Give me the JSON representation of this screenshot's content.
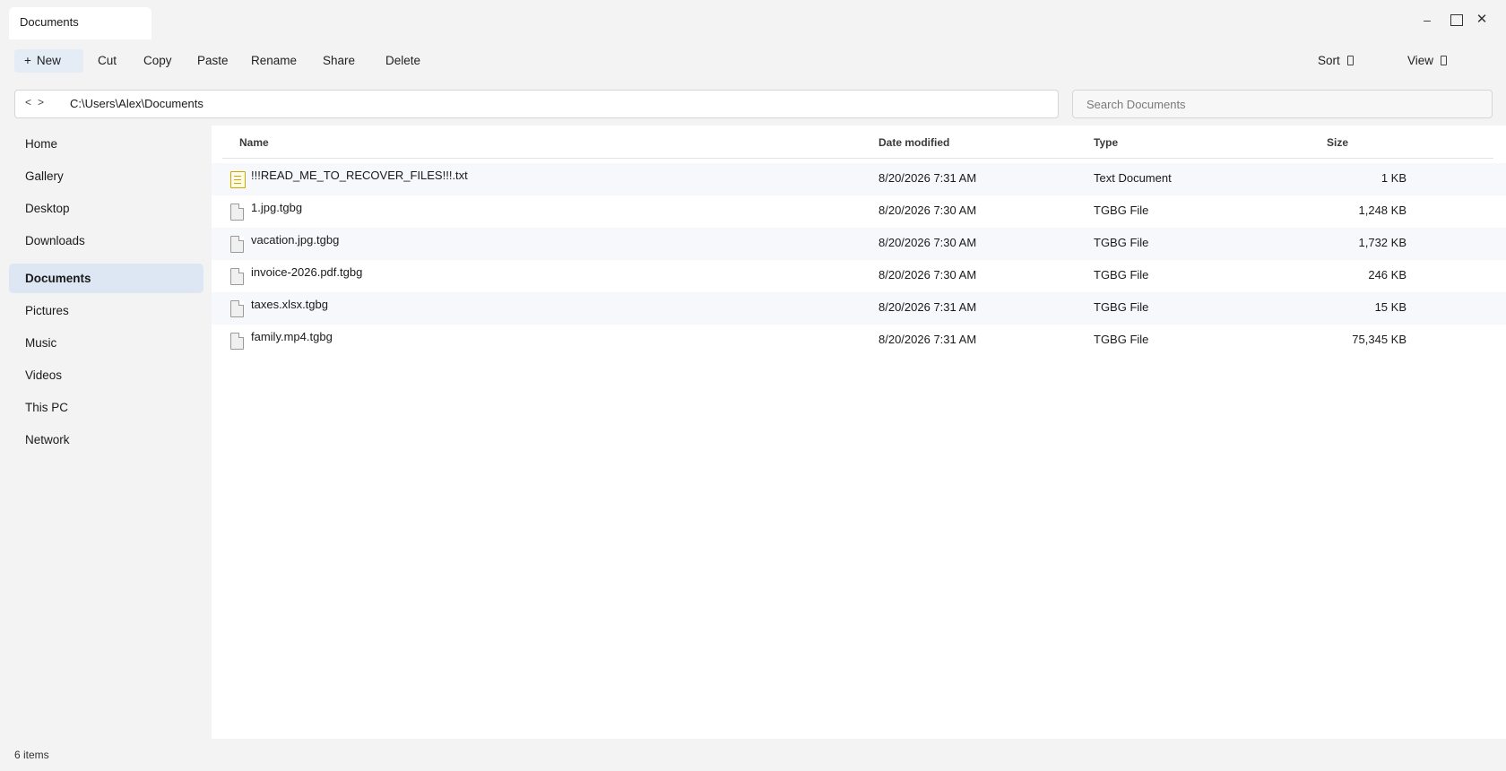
{
  "window": {
    "tab_title": "Documents",
    "controls": {
      "minimize": "–",
      "close": "✕"
    }
  },
  "toolbar": {
    "new_label": "New",
    "new_plus": "+",
    "cut_label": "Cut",
    "copy_label": "Copy",
    "paste_label": "Paste",
    "rename_label": "Rename",
    "share_label": "Share",
    "delete_label": "Delete",
    "sort_label": "Sort",
    "view_label": "View"
  },
  "address": {
    "back": "<",
    "forward": ">",
    "path": "C:\\Users\\Alex\\Documents"
  },
  "search": {
    "placeholder": "Search Documents"
  },
  "sidebar": {
    "items": [
      {
        "label": "Home"
      },
      {
        "label": "Gallery"
      },
      {
        "label": "Desktop"
      },
      {
        "label": "Downloads"
      },
      {
        "label": "Documents",
        "active": true
      },
      {
        "label": "Pictures"
      },
      {
        "label": "Music"
      },
      {
        "label": "Videos"
      },
      {
        "label": "This PC"
      },
      {
        "label": "Network"
      }
    ]
  },
  "table": {
    "headers": {
      "name": "Name",
      "date": "Date modified",
      "type": "Type",
      "size": "Size"
    },
    "rows": [
      {
        "name": "!!!READ_ME_TO_RECOVER_FILES!!!.txt",
        "date": "8/20/2026 7:31 AM",
        "type": "Text Document",
        "size": "1 KB",
        "icon": "text-file-icon"
      },
      {
        "name": "1.jpg.tgbg",
        "date": "8/20/2026 7:30 AM",
        "type": "TGBG File",
        "size": "1,248 KB",
        "icon": "file-icon"
      },
      {
        "name": "vacation.jpg.tgbg",
        "date": "8/20/2026 7:30 AM",
        "type": "TGBG File",
        "size": "1,732 KB",
        "icon": "file-icon"
      },
      {
        "name": "invoice-2026.pdf.tgbg",
        "date": "8/20/2026 7:30 AM",
        "type": "TGBG File",
        "size": "246 KB",
        "icon": "file-icon"
      },
      {
        "name": "taxes.xlsx.tgbg",
        "date": "8/20/2026 7:31 AM",
        "type": "TGBG File",
        "size": "15 KB",
        "icon": "file-icon"
      },
      {
        "name": "family.mp4.tgbg",
        "date": "8/20/2026 7:31 AM",
        "type": "TGBG File",
        "size": "75,345 KB",
        "icon": "file-icon"
      }
    ]
  },
  "status": {
    "item_count": "6 items"
  },
  "colors": {
    "active_sidebar": "#dde7f3",
    "new_button": "#e4ecf6",
    "text_icon": "#c9a800"
  }
}
